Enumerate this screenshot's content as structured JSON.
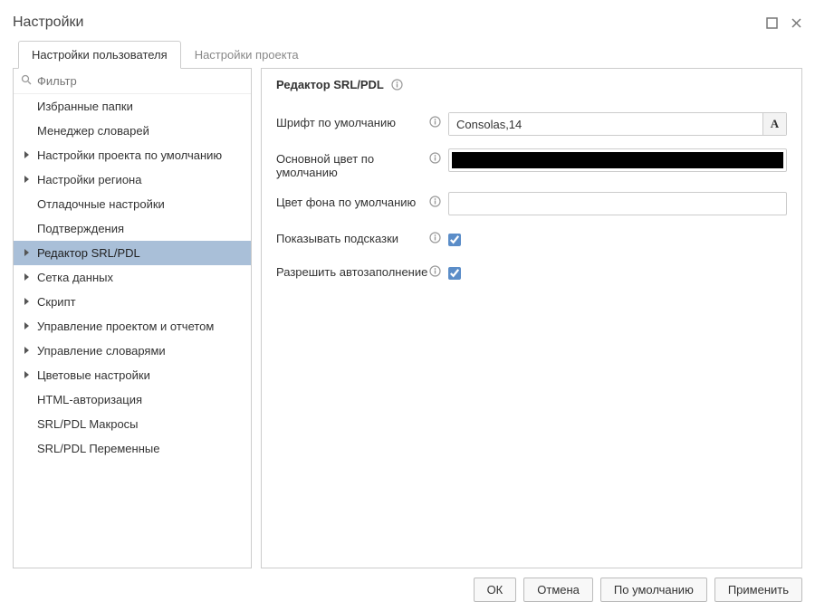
{
  "window": {
    "title": "Настройки"
  },
  "tabs": {
    "user": "Настройки пользователя",
    "project": "Настройки проекта"
  },
  "filter": {
    "placeholder": "Фильтр"
  },
  "tree": [
    {
      "label": "Избранные папки",
      "children": false,
      "selected": false
    },
    {
      "label": "Менеджер словарей",
      "children": false,
      "selected": false
    },
    {
      "label": "Настройки проекта по умолчанию",
      "children": true,
      "selected": false
    },
    {
      "label": "Настройки региона",
      "children": true,
      "selected": false
    },
    {
      "label": "Отладочные настройки",
      "children": false,
      "selected": false
    },
    {
      "label": "Подтверждения",
      "children": false,
      "selected": false
    },
    {
      "label": "Редактор SRL/PDL",
      "children": true,
      "selected": true
    },
    {
      "label": "Сетка данных",
      "children": true,
      "selected": false
    },
    {
      "label": "Скрипт",
      "children": true,
      "selected": false
    },
    {
      "label": "Управление проектом и отчетом",
      "children": true,
      "selected": false
    },
    {
      "label": "Управление словарями",
      "children": true,
      "selected": false
    },
    {
      "label": "Цветовые настройки",
      "children": true,
      "selected": false
    },
    {
      "label": "HTML-авторизация",
      "children": false,
      "selected": false
    },
    {
      "label": "SRL/PDL Макросы",
      "children": false,
      "selected": false
    },
    {
      "label": "SRL/PDL Переменные",
      "children": false,
      "selected": false
    }
  ],
  "panel": {
    "title": "Редактор SRL/PDL",
    "font_label": "Шрифт по умолчанию",
    "font_value": "Consolas,14",
    "font_button": "A",
    "fgcolor_label": "Основной цвет по умолчанию",
    "fgcolor_value": "#000000",
    "bgcolor_label": "Цвет фона по умолчанию",
    "bgcolor_value": "#ffffff",
    "hints_label": "Показывать подсказки",
    "hints_checked": true,
    "autocomplete_label": "Разрешить автозаполнение",
    "autocomplete_checked": true
  },
  "buttons": {
    "ok": "ОК",
    "cancel": "Отмена",
    "defaults": "По умолчанию",
    "apply": "Применить"
  }
}
